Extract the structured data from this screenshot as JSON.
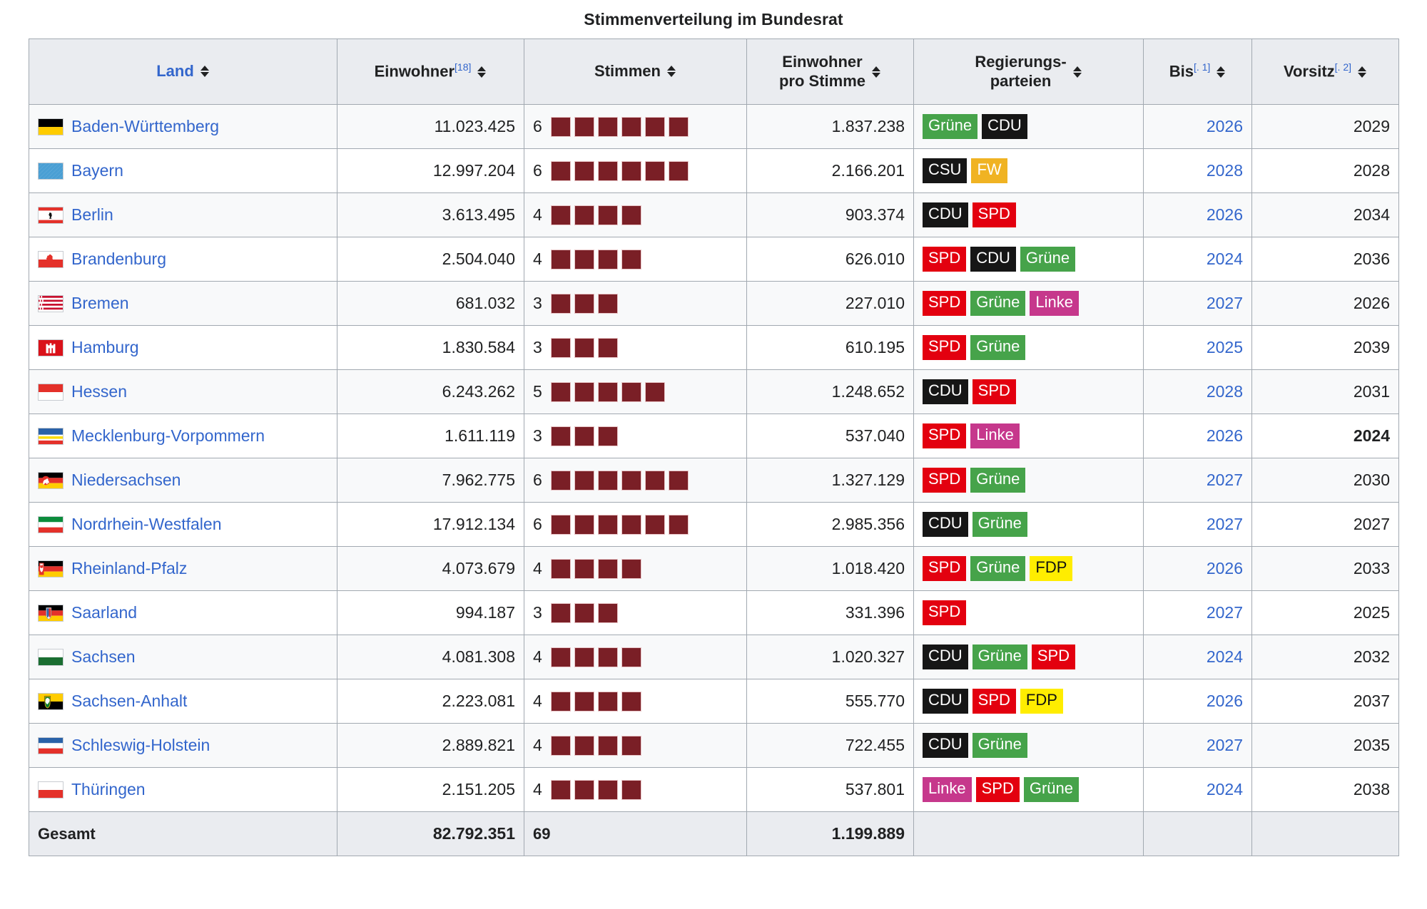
{
  "caption": "Stimmenverteilung im Bundesrat",
  "columns": [
    {
      "key": "land",
      "label": "Land",
      "ref": "",
      "sortable": true,
      "link": true
    },
    {
      "key": "einw",
      "label": "Einwohner",
      "ref": "[18]",
      "sortable": true,
      "link": false
    },
    {
      "key": "stimmen",
      "label": "Stimmen",
      "ref": "",
      "sortable": true,
      "link": false
    },
    {
      "key": "eps",
      "label_line1": "Einwohner",
      "label_line2": "pro Stimme",
      "ref": "",
      "sortable": true,
      "link": false
    },
    {
      "key": "reg",
      "label_line1": "Regierungs-",
      "label_line2": "parteien",
      "ref": "",
      "sortable": true,
      "link": false
    },
    {
      "key": "bis",
      "label": "Bis",
      "ref": "[. 1]",
      "sortable": true,
      "link": false
    },
    {
      "key": "vorsitz",
      "label": "Vorsitz",
      "ref": "[. 2]",
      "sortable": true,
      "link": false
    }
  ],
  "rows": [
    {
      "land": "Baden-Württemberg",
      "flag": "flag-baden-wuerttemberg",
      "einwohner": "11.023.425",
      "stimmen": 6,
      "einwohner_pro_stimme": "1.837.238",
      "parteien": [
        "Grüne",
        "CDU"
      ],
      "bis": "2026",
      "vorsitz": "2029",
      "vorsitz_bold": false
    },
    {
      "land": "Bayern",
      "flag": "flag-bayern",
      "einwohner": "12.997.204",
      "stimmen": 6,
      "einwohner_pro_stimme": "2.166.201",
      "parteien": [
        "CSU",
        "FW"
      ],
      "bis": "2028",
      "vorsitz": "2028",
      "vorsitz_bold": false
    },
    {
      "land": "Berlin",
      "flag": "flag-berlin",
      "einwohner": "3.613.495",
      "stimmen": 4,
      "einwohner_pro_stimme": "903.374",
      "parteien": [
        "CDU",
        "SPD"
      ],
      "bis": "2026",
      "vorsitz": "2034",
      "vorsitz_bold": false
    },
    {
      "land": "Brandenburg",
      "flag": "flag-brandenburg",
      "einwohner": "2.504.040",
      "stimmen": 4,
      "einwohner_pro_stimme": "626.010",
      "parteien": [
        "SPD",
        "CDU",
        "Grüne"
      ],
      "bis": "2024",
      "vorsitz": "2036",
      "vorsitz_bold": false
    },
    {
      "land": "Bremen",
      "flag": "flag-bremen",
      "einwohner": "681.032",
      "stimmen": 3,
      "einwohner_pro_stimme": "227.010",
      "parteien": [
        "SPD",
        "Grüne",
        "Linke"
      ],
      "bis": "2027",
      "vorsitz": "2026",
      "vorsitz_bold": false
    },
    {
      "land": "Hamburg",
      "flag": "flag-hamburg",
      "einwohner": "1.830.584",
      "stimmen": 3,
      "einwohner_pro_stimme": "610.195",
      "parteien": [
        "SPD",
        "Grüne"
      ],
      "bis": "2025",
      "vorsitz": "2039",
      "vorsitz_bold": false
    },
    {
      "land": "Hessen",
      "flag": "flag-hessen",
      "einwohner": "6.243.262",
      "stimmen": 5,
      "einwohner_pro_stimme": "1.248.652",
      "parteien": [
        "CDU",
        "SPD"
      ],
      "bis": "2028",
      "vorsitz": "2031",
      "vorsitz_bold": false
    },
    {
      "land": "Mecklenburg-Vorpommern",
      "flag": "flag-mecklenburg-vorpommern",
      "einwohner": "1.611.119",
      "stimmen": 3,
      "einwohner_pro_stimme": "537.040",
      "parteien": [
        "SPD",
        "Linke"
      ],
      "bis": "2026",
      "vorsitz": "2024",
      "vorsitz_bold": true
    },
    {
      "land": "Niedersachsen",
      "flag": "flag-niedersachsen",
      "einwohner": "7.962.775",
      "stimmen": 6,
      "einwohner_pro_stimme": "1.327.129",
      "parteien": [
        "SPD",
        "Grüne"
      ],
      "bis": "2027",
      "vorsitz": "2030",
      "vorsitz_bold": false
    },
    {
      "land": "Nordrhein-Westfalen",
      "flag": "flag-nordrhein-westfalen",
      "einwohner": "17.912.134",
      "stimmen": 6,
      "einwohner_pro_stimme": "2.985.356",
      "parteien": [
        "CDU",
        "Grüne"
      ],
      "bis": "2027",
      "vorsitz": "2027",
      "vorsitz_bold": false
    },
    {
      "land": "Rheinland-Pfalz",
      "flag": "flag-rheinland-pfalz",
      "einwohner": "4.073.679",
      "stimmen": 4,
      "einwohner_pro_stimme": "1.018.420",
      "parteien": [
        "SPD",
        "Grüne",
        "FDP"
      ],
      "bis": "2026",
      "vorsitz": "2033",
      "vorsitz_bold": false
    },
    {
      "land": "Saarland",
      "flag": "flag-saarland",
      "einwohner": "994.187",
      "stimmen": 3,
      "einwohner_pro_stimme": "331.396",
      "parteien": [
        "SPD"
      ],
      "bis": "2027",
      "vorsitz": "2025",
      "vorsitz_bold": false
    },
    {
      "land": "Sachsen",
      "flag": "flag-sachsen",
      "einwohner": "4.081.308",
      "stimmen": 4,
      "einwohner_pro_stimme": "1.020.327",
      "parteien": [
        "CDU",
        "Grüne",
        "SPD"
      ],
      "bis": "2024",
      "vorsitz": "2032",
      "vorsitz_bold": false
    },
    {
      "land": "Sachsen-Anhalt",
      "flag": "flag-sachsen-anhalt",
      "einwohner": "2.223.081",
      "stimmen": 4,
      "einwohner_pro_stimme": "555.770",
      "parteien": [
        "CDU",
        "SPD",
        "FDP"
      ],
      "bis": "2026",
      "vorsitz": "2037",
      "vorsitz_bold": false
    },
    {
      "land": "Schleswig-Holstein",
      "flag": "flag-schleswig-holstein",
      "einwohner": "2.889.821",
      "stimmen": 4,
      "einwohner_pro_stimme": "722.455",
      "parteien": [
        "CDU",
        "Grüne"
      ],
      "bis": "2027",
      "vorsitz": "2035",
      "vorsitz_bold": false
    },
    {
      "land": "Thüringen",
      "flag": "flag-thueringen",
      "einwohner": "2.151.205",
      "stimmen": 4,
      "einwohner_pro_stimme": "537.801",
      "parteien": [
        "Linke",
        "SPD",
        "Grüne"
      ],
      "bis": "2024",
      "vorsitz": "2038",
      "vorsitz_bold": false
    }
  ],
  "total": {
    "label": "Gesamt",
    "einwohner": "82.792.351",
    "stimmen": "69",
    "einwohner_pro_stimme": "1.199.889",
    "parteien": "",
    "bis": "",
    "vorsitz": ""
  },
  "party_colors": {
    "Grüne": "#46a34a",
    "CDU": "#161616",
    "CSU": "#161616",
    "SPD": "#e3000f",
    "FW": "#f0b323",
    "Linke": "#c6388c",
    "FDP": "#ffed00"
  },
  "vote_square_color": "#7a1f26",
  "link_color": "#3366cc",
  "header_bg": "#eaecf0",
  "border_color": "#a2a9b1"
}
